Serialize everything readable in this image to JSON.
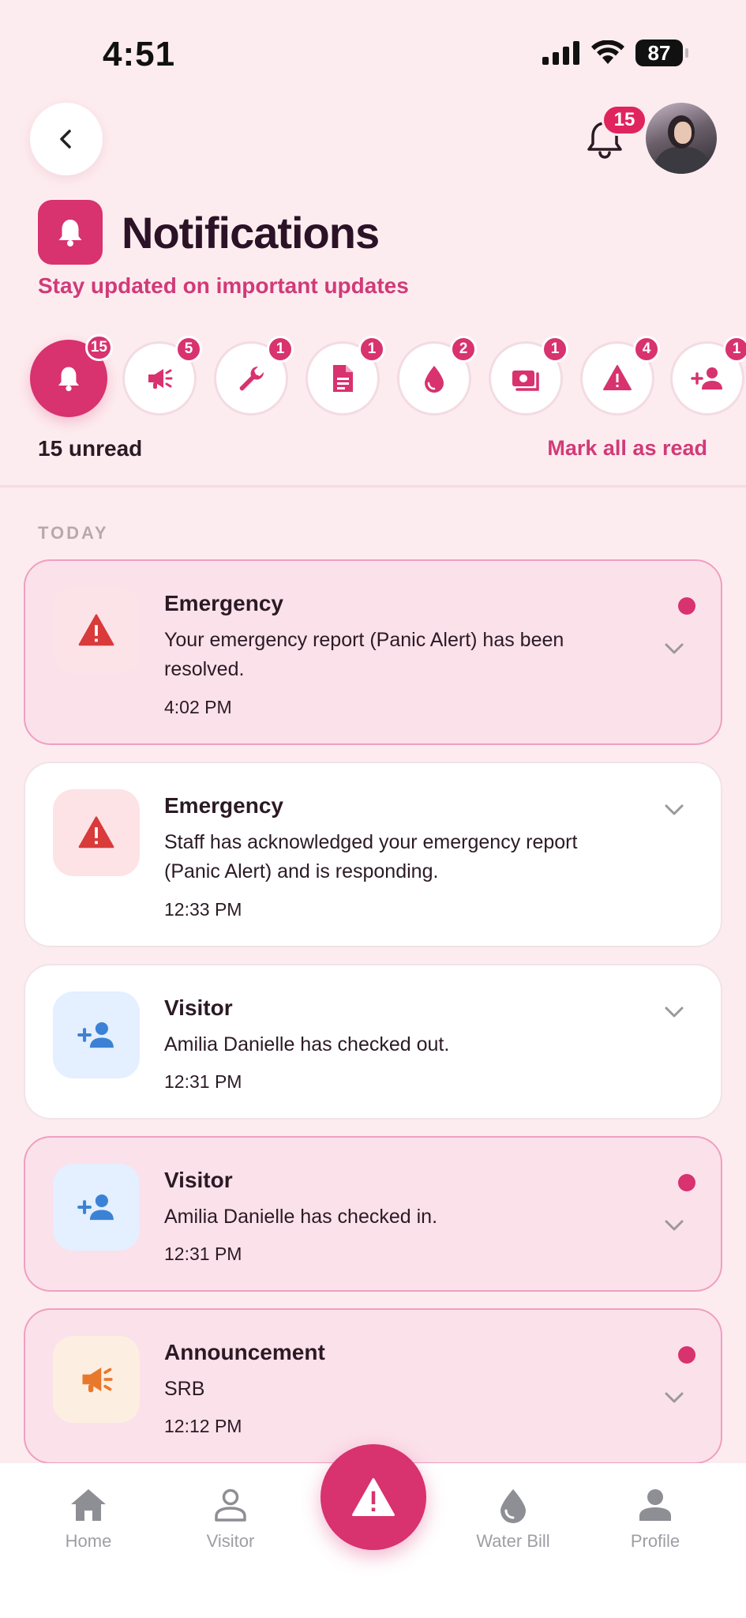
{
  "status_bar": {
    "time": "4:51",
    "battery": "87"
  },
  "header": {
    "notification_count": "15"
  },
  "title": {
    "text": "Notifications",
    "subtitle": "Stay updated on important updates"
  },
  "filters": [
    {
      "name": "all",
      "icon": "bell-icon",
      "count": "15",
      "active": true
    },
    {
      "name": "announcement",
      "icon": "megaphone-icon",
      "count": "5"
    },
    {
      "name": "maintenance",
      "icon": "wrench-icon",
      "count": "1"
    },
    {
      "name": "document",
      "icon": "document-icon",
      "count": "1"
    },
    {
      "name": "water",
      "icon": "water-drop-icon",
      "count": "2"
    },
    {
      "name": "billing",
      "icon": "bill-icon",
      "count": "1"
    },
    {
      "name": "emergency",
      "icon": "warning-icon",
      "count": "4"
    },
    {
      "name": "visitor",
      "icon": "add-person-icon",
      "count": "1"
    }
  ],
  "summary": {
    "unread": "15 unread",
    "mark_all": "Mark all as read"
  },
  "section": {
    "today": "TODAY"
  },
  "notifications": [
    {
      "title": "Emergency",
      "message": "Your emergency report (Panic Alert) has been resolved.",
      "time": "4:02 PM",
      "unread": true,
      "icon": "warning-icon"
    },
    {
      "title": "Emergency",
      "message": "Staff has acknowledged your emergency report (Panic Alert) and is responding.",
      "time": "12:33 PM",
      "unread": false,
      "icon": "warning-icon"
    },
    {
      "title": "Visitor",
      "message": "Amilia Danielle has checked out.",
      "time": "12:31 PM",
      "unread": false,
      "icon": "add-person-icon"
    },
    {
      "title": "Visitor",
      "message": "Amilia Danielle has checked in.",
      "time": "12:31 PM",
      "unread": true,
      "icon": "add-person-icon"
    },
    {
      "title": "Announcement",
      "message": "SRB",
      "time": "12:12 PM",
      "unread": true,
      "icon": "megaphone-icon"
    }
  ],
  "bottom_nav": [
    {
      "label": "Home",
      "icon": "home-icon"
    },
    {
      "label": "Visitor",
      "icon": "person-outline-icon"
    },
    {
      "label": "Water Bill",
      "icon": "water-drop-icon"
    },
    {
      "label": "Profile",
      "icon": "person-icon"
    }
  ],
  "colors": {
    "accent": "#d8326f",
    "background": "#fdecef",
    "unread_card": "#fbe1ea",
    "emergency_red": "#d93a3a",
    "visitor_blue": "#3b82d6",
    "announcement_orange": "#e8792c"
  }
}
